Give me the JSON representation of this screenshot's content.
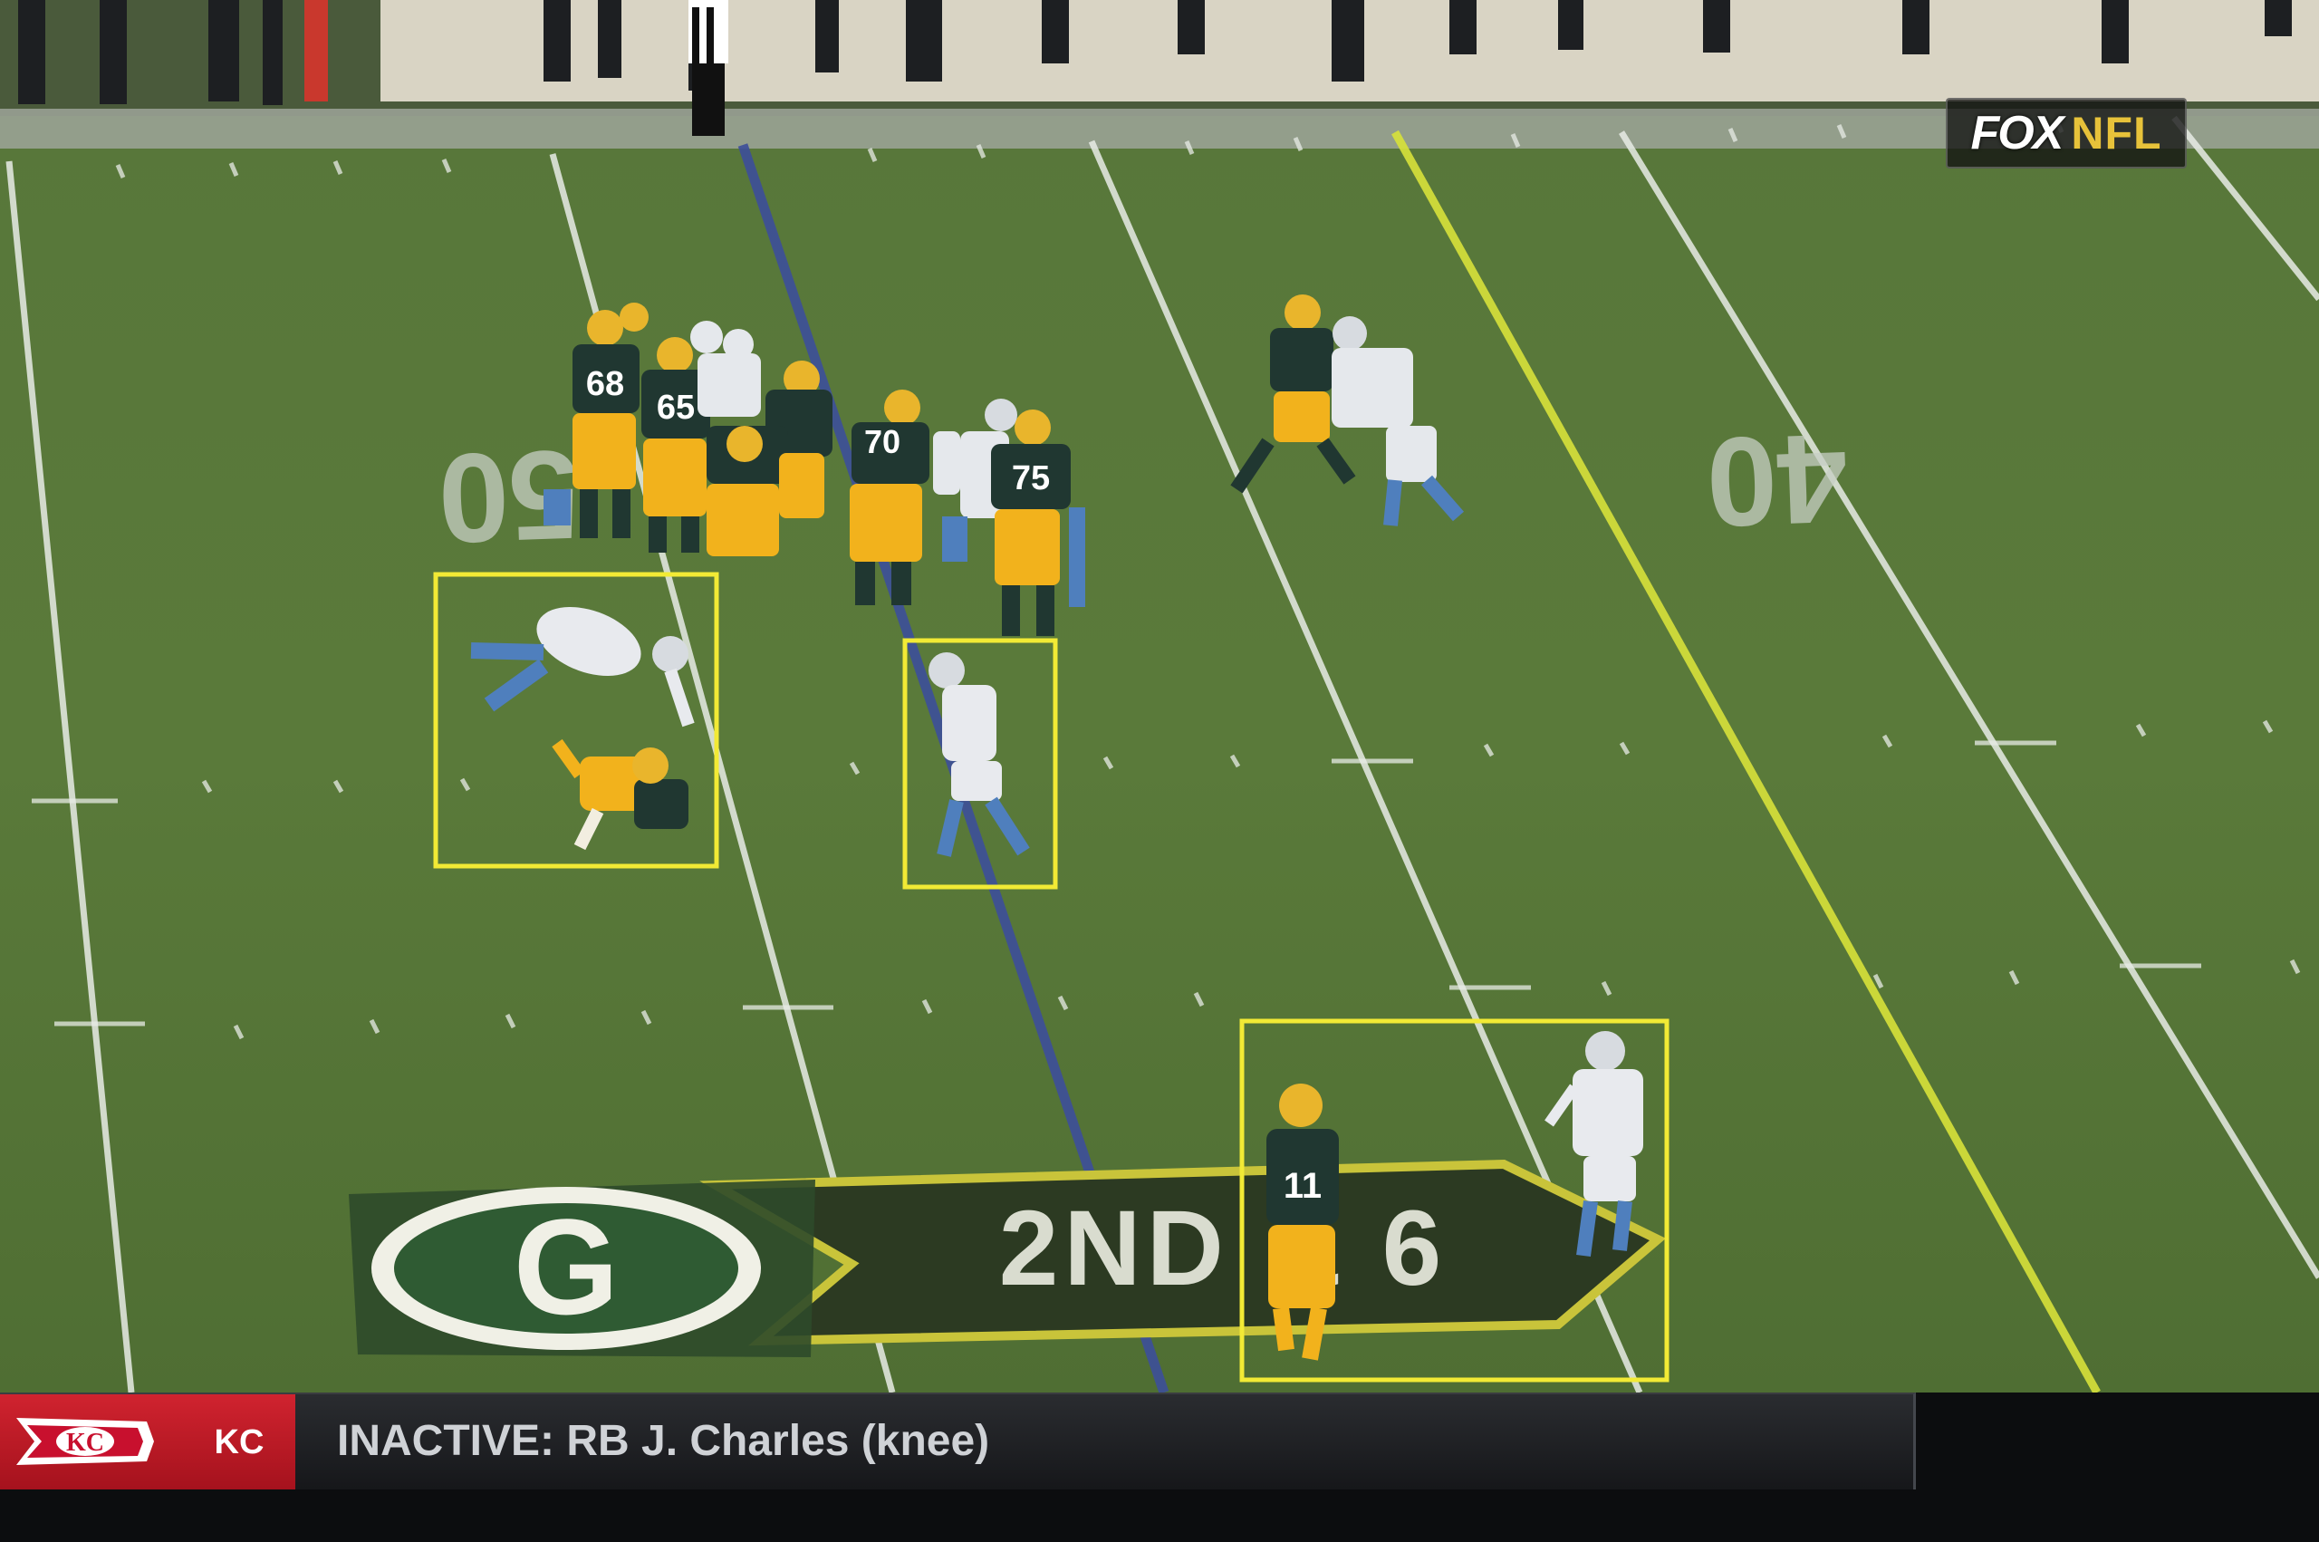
{
  "broadcast": {
    "network": "FOX",
    "league": "NFL",
    "colors": {
      "fox_white": "#ffffff",
      "nfl_gold": "#e7c23a"
    }
  },
  "field": {
    "yard_numbers": [
      "50",
      "40"
    ],
    "down_and_distance_decal": "2ND & 6",
    "midfield_logo": "green-bay-g-logo",
    "colors": {
      "turf": "#5a7a3a",
      "line_of_scrimmage": "#3d4f9a",
      "first_down_line": "#d8e23a",
      "packers_green": "#203731",
      "packers_gold": "#ffb612",
      "lions_blue": "#4f7fbd",
      "highlight_box": "#f2ea35"
    }
  },
  "jersey_numbers": [
    "68",
    "65",
    "70",
    "75",
    "11"
  ],
  "highlight_boxes": [
    {
      "label": "fallen-players-box"
    },
    {
      "label": "defender-box"
    },
    {
      "label": "receiver-and-defender-box"
    }
  ],
  "ticker": {
    "team_abbr": "KC",
    "team_logo": "arrowhead-logo",
    "team_color": "#c8102e",
    "message": "INACTIVE: RB J. Charles (knee)"
  }
}
